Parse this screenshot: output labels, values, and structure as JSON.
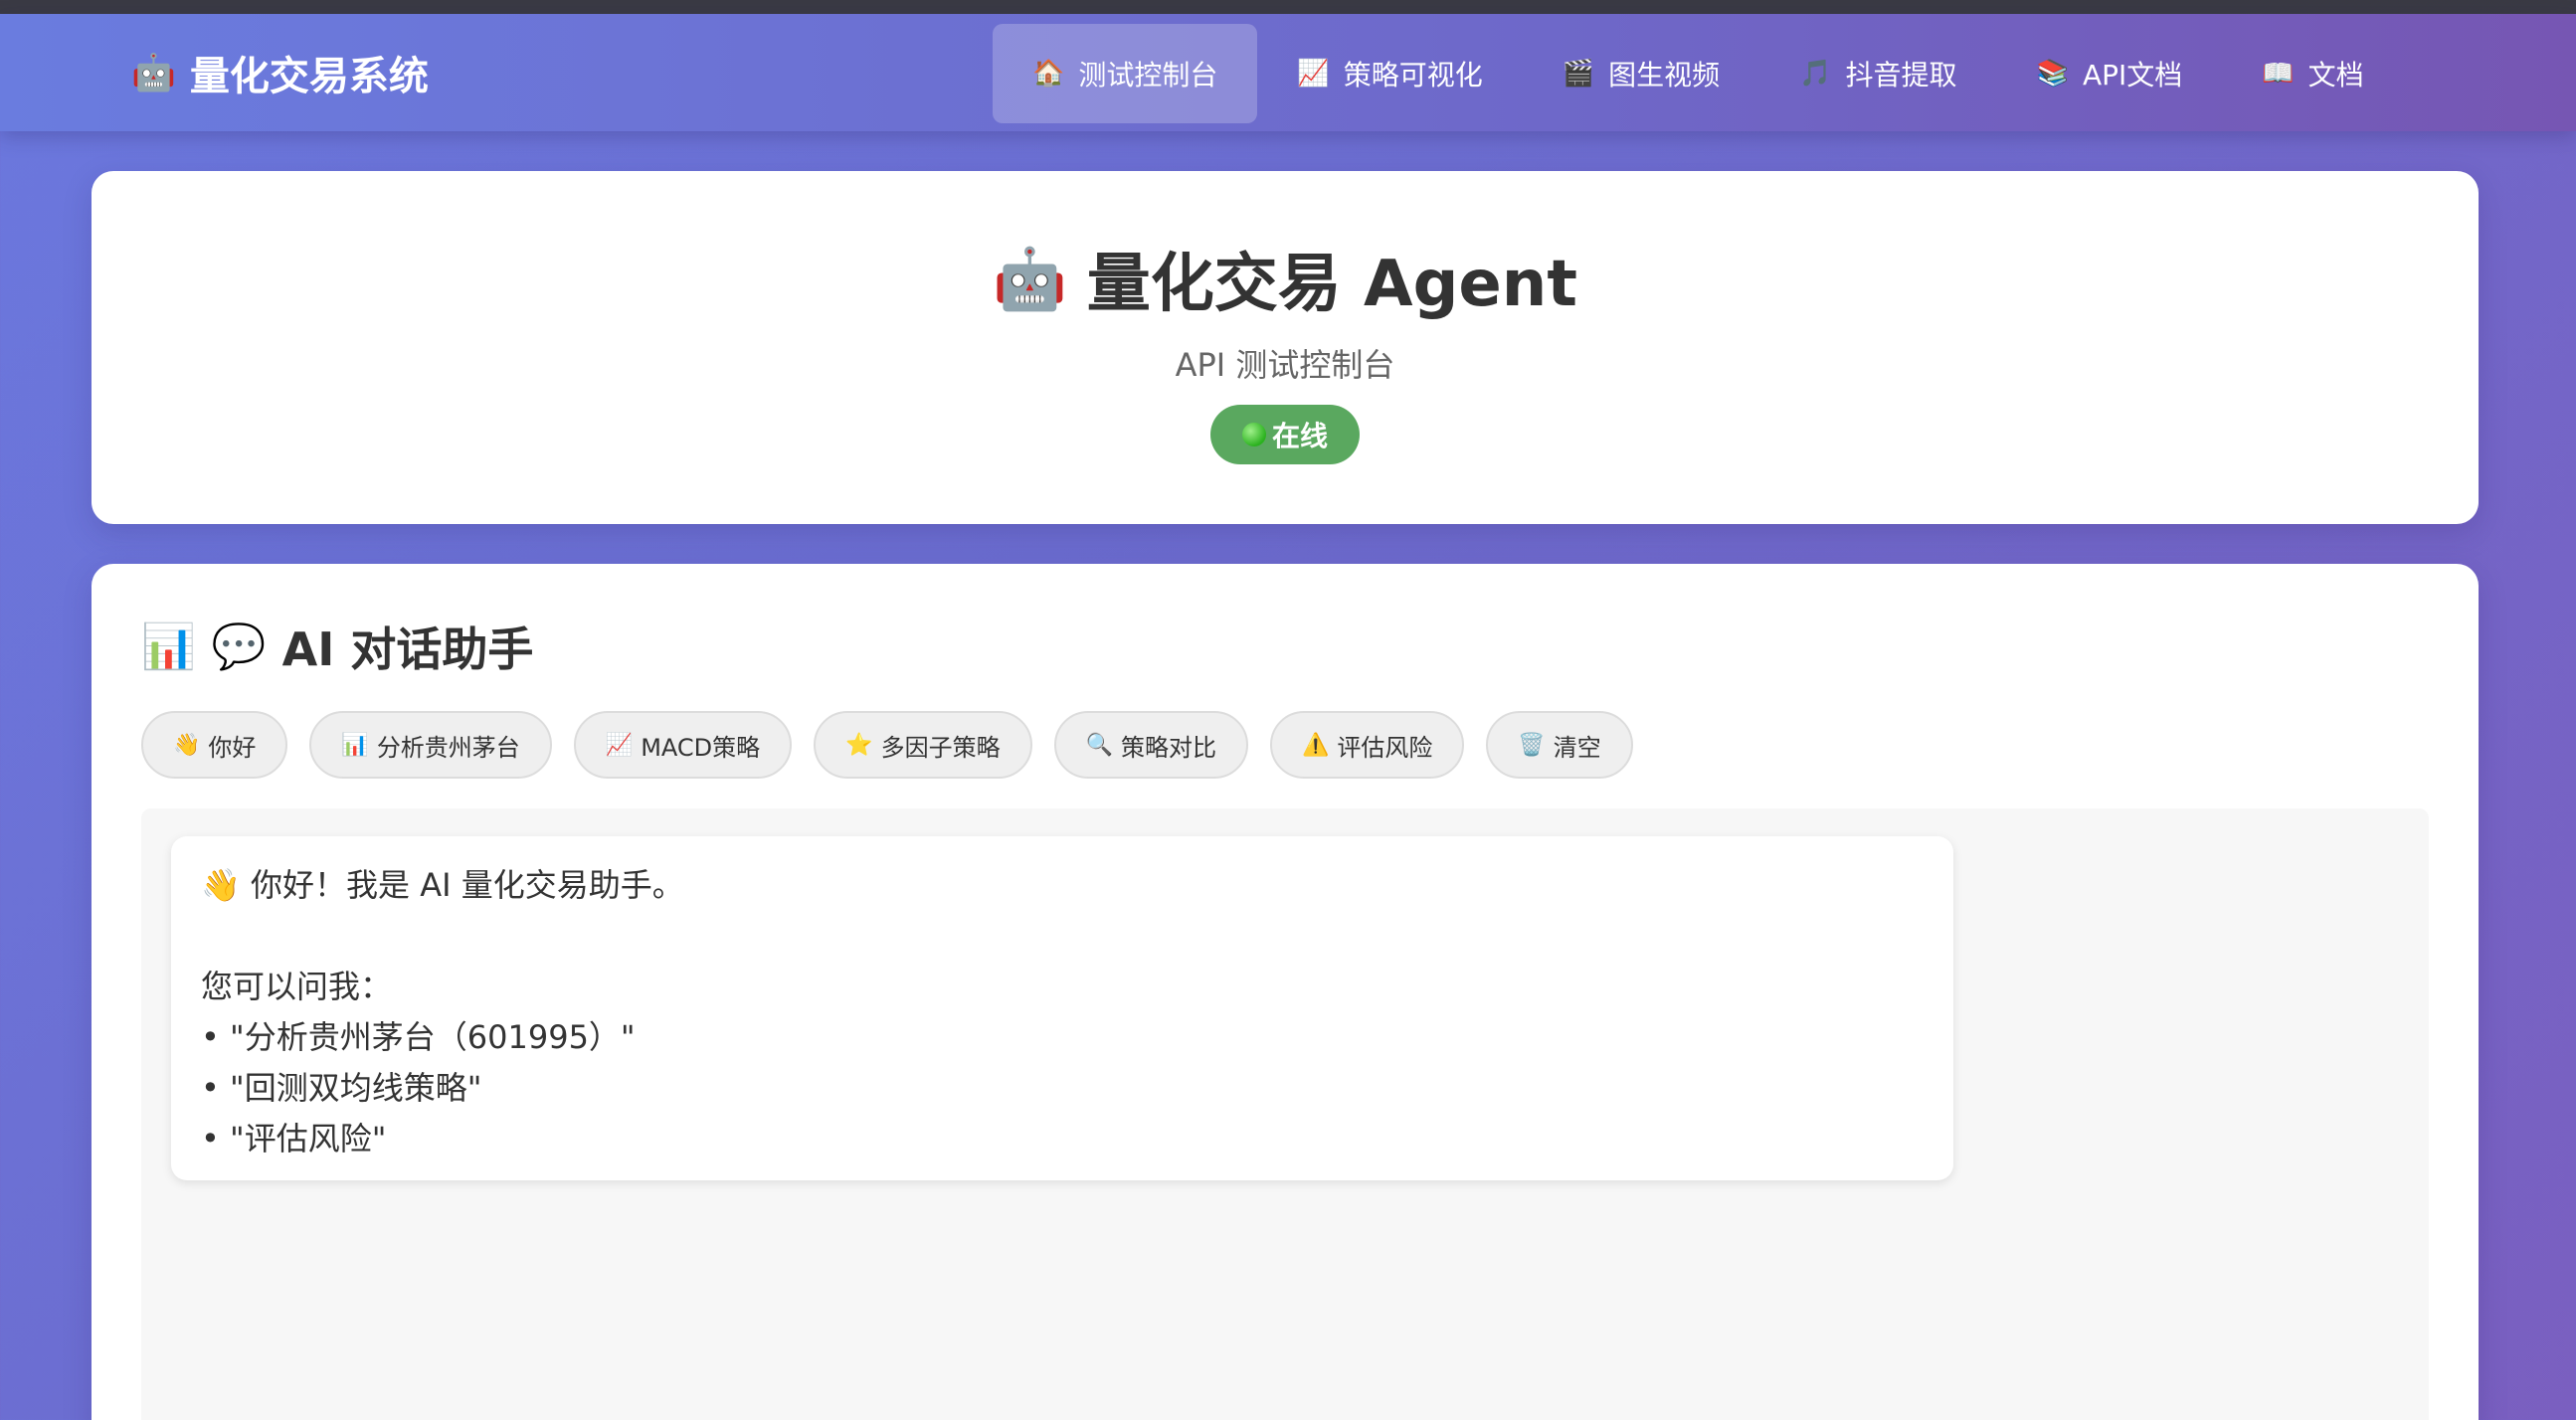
{
  "nav": {
    "brand": {
      "icon": "🤖",
      "label": "量化交易系统"
    },
    "links": [
      {
        "icon": "🏠",
        "label": "测试控制台",
        "active": true
      },
      {
        "icon": "📈",
        "label": "策略可视化",
        "active": false
      },
      {
        "icon": "🎬",
        "label": "图生视频",
        "active": false
      },
      {
        "icon": "🎵",
        "label": "抖音提取",
        "active": false
      },
      {
        "icon": "📚",
        "label": "API文档",
        "active": false
      },
      {
        "icon": "📖",
        "label": "文档",
        "active": false
      }
    ]
  },
  "header": {
    "icon": "🤖",
    "title": "量化交易 Agent",
    "subtitle": "API 测试控制台",
    "status": {
      "label": "在线",
      "color": "#5aa85f"
    }
  },
  "chat": {
    "title_icons": [
      "📊",
      "💬"
    ],
    "title": "AI 对话助手",
    "quick_actions": [
      {
        "icon": "👋",
        "label": "你好"
      },
      {
        "icon": "📊",
        "label": "分析贵州茅台"
      },
      {
        "icon": "📈",
        "label": "MACD策略"
      },
      {
        "icon": "⭐",
        "label": "多因子策略"
      },
      {
        "icon": "🔍",
        "label": "策略对比"
      },
      {
        "icon": "⚠️",
        "label": "评估风险"
      },
      {
        "icon": "🗑️",
        "label": "清空"
      }
    ],
    "messages": [
      {
        "lines": [
          "👋 你好！我是 AI 量化交易助手。",
          "",
          "您可以问我：",
          "• \"分析贵州茅台（601995）\"",
          "• \"回测双均线策略\"",
          "• \"评估风险\""
        ]
      }
    ]
  },
  "colors": {
    "accent": "#6b78de",
    "status_green": "#5aa85f"
  }
}
